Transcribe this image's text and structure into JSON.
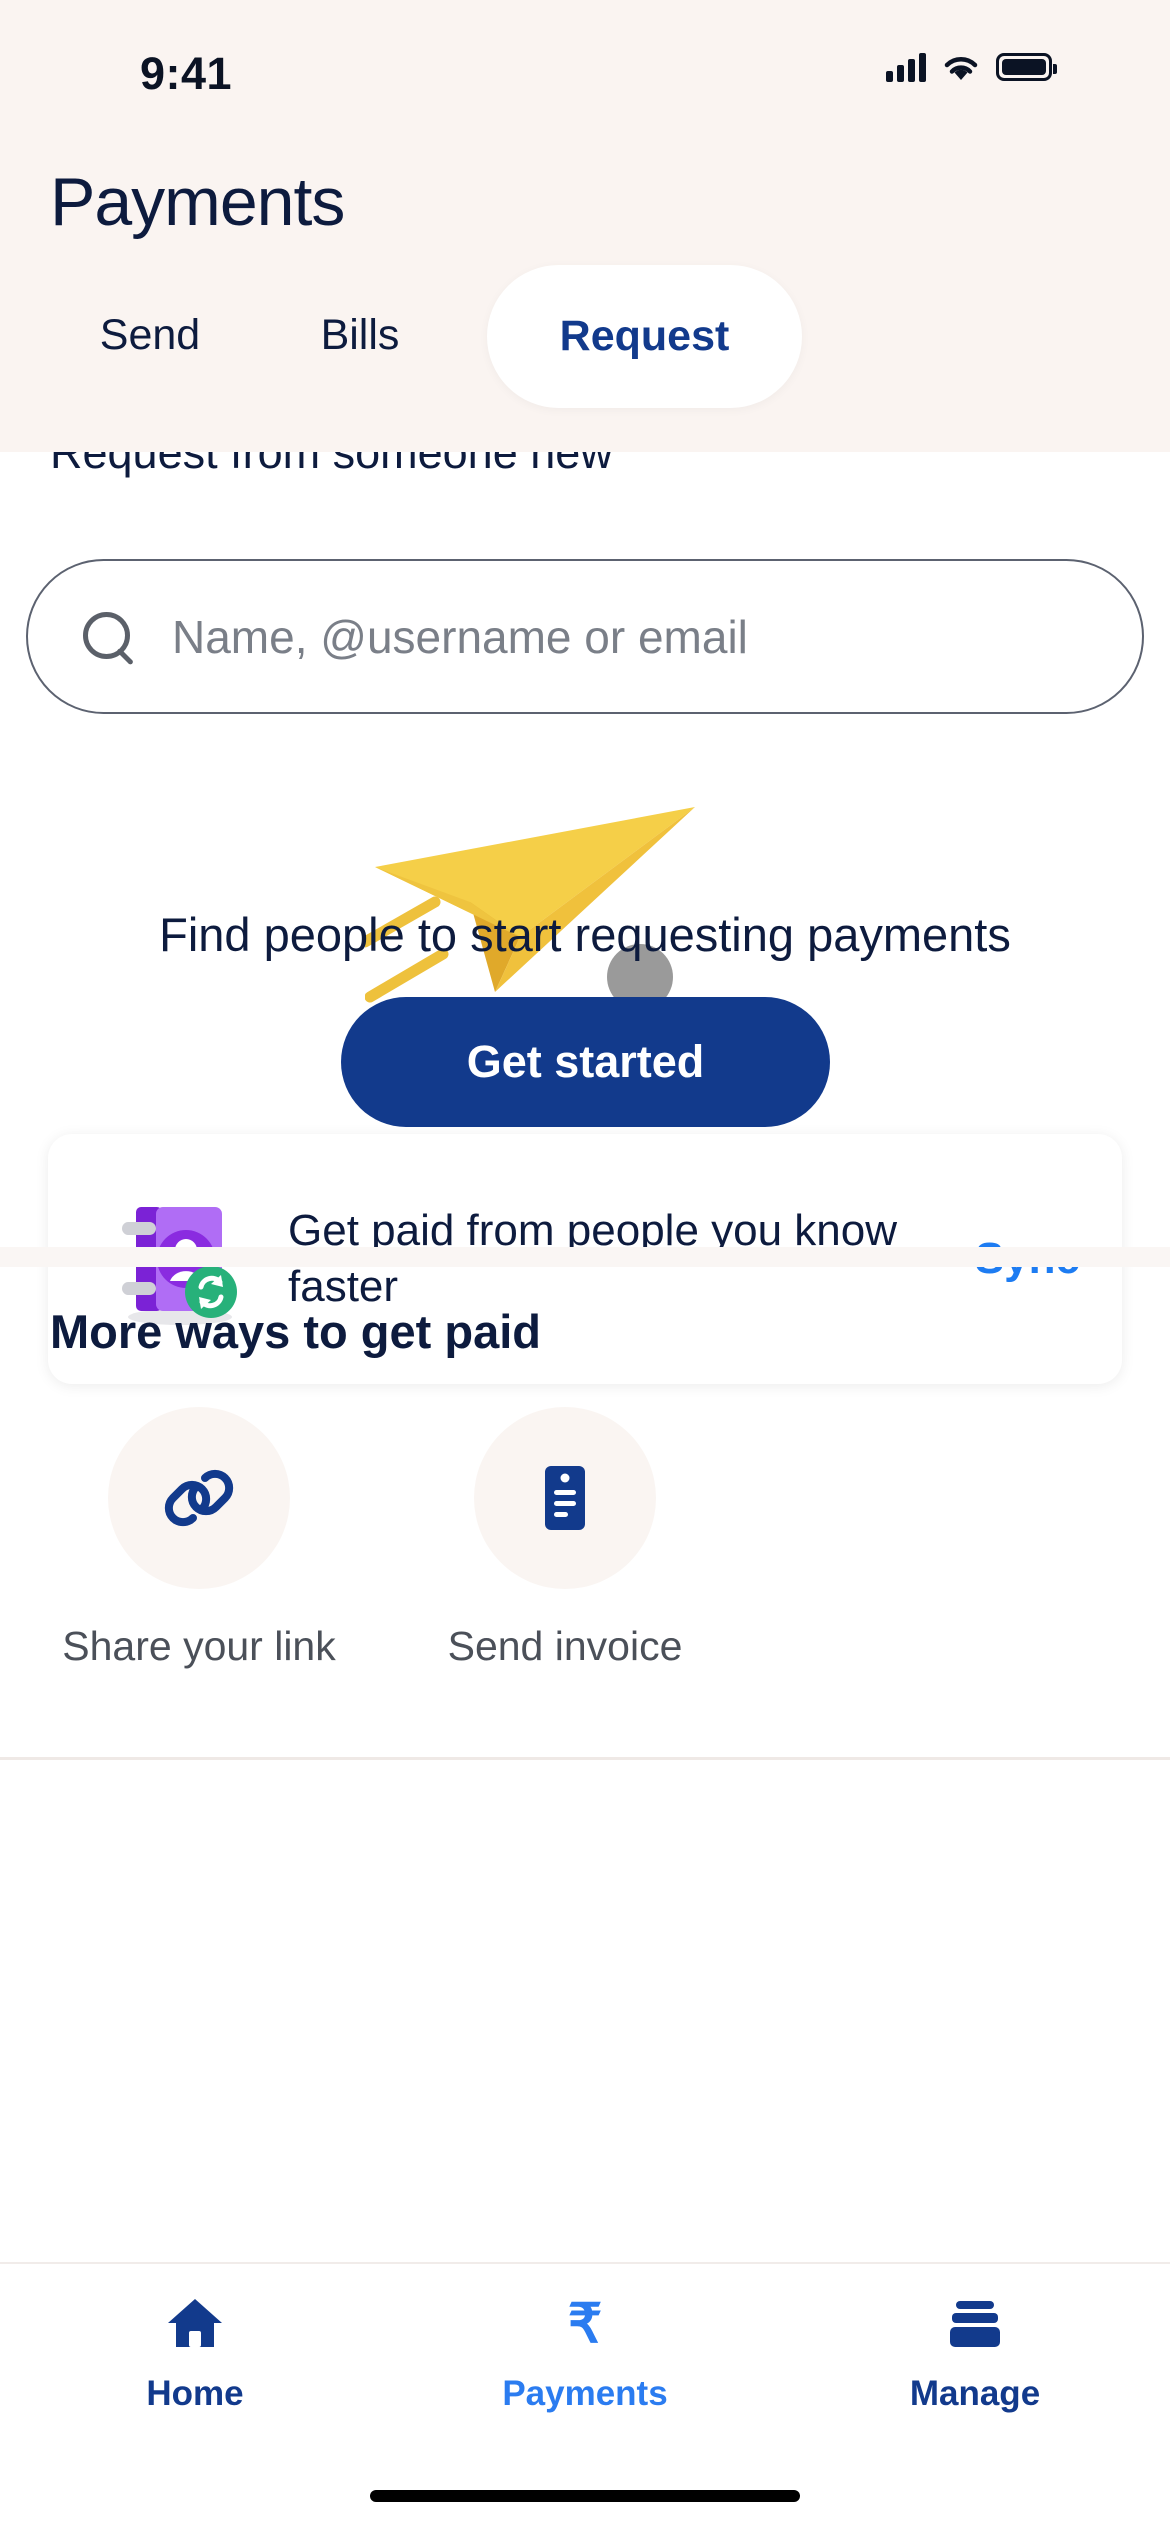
{
  "statusbar": {
    "time": "9:41",
    "signal_icon": "cellular-signal-icon",
    "wifi_icon": "wifi-icon",
    "battery_icon": "battery-full-icon"
  },
  "header": {
    "title": "Payments",
    "tabs": [
      {
        "label": "Send",
        "active": false
      },
      {
        "label": "Bills",
        "active": false
      },
      {
        "label": "Request",
        "active": true
      }
    ]
  },
  "main": {
    "clipped_heading": "Request from someone new",
    "search": {
      "placeholder": "Name, @username or email",
      "value": "",
      "icon": "search-icon"
    },
    "illustration": {
      "name": "paper-plane-illustration",
      "plane_color": "#f5cf48",
      "plane_shadow_color": "#e0a92a",
      "dot_color": "#9a9a9a"
    },
    "empty_state": {
      "title": "Find people to start requesting payments",
      "cta_label": "Get started"
    },
    "sync_card": {
      "icon": "address-book-sync-icon",
      "text": "Get paid from people you know faster",
      "action_label": "Sync",
      "action_color": "#1d7cf2"
    },
    "more_ways": {
      "title": "More ways to get paid",
      "tiles": [
        {
          "icon": "link-chain-icon",
          "label": "Share your link"
        },
        {
          "icon": "invoice-document-icon",
          "label": "Send invoice"
        }
      ]
    }
  },
  "tabbar": {
    "items": [
      {
        "icon": "home-icon",
        "label": "Home",
        "active": false
      },
      {
        "icon": "rupee-icon",
        "label": "Payments",
        "active": true
      },
      {
        "icon": "manage-cards-icon",
        "label": "Manage",
        "active": false
      }
    ]
  },
  "colors": {
    "header_bg": "#faf4f1",
    "brand_navy": "#123a8c",
    "text_navy": "#0d1b3e",
    "accent_blue": "#2b7cf0",
    "muted_text": "#4b5059"
  }
}
